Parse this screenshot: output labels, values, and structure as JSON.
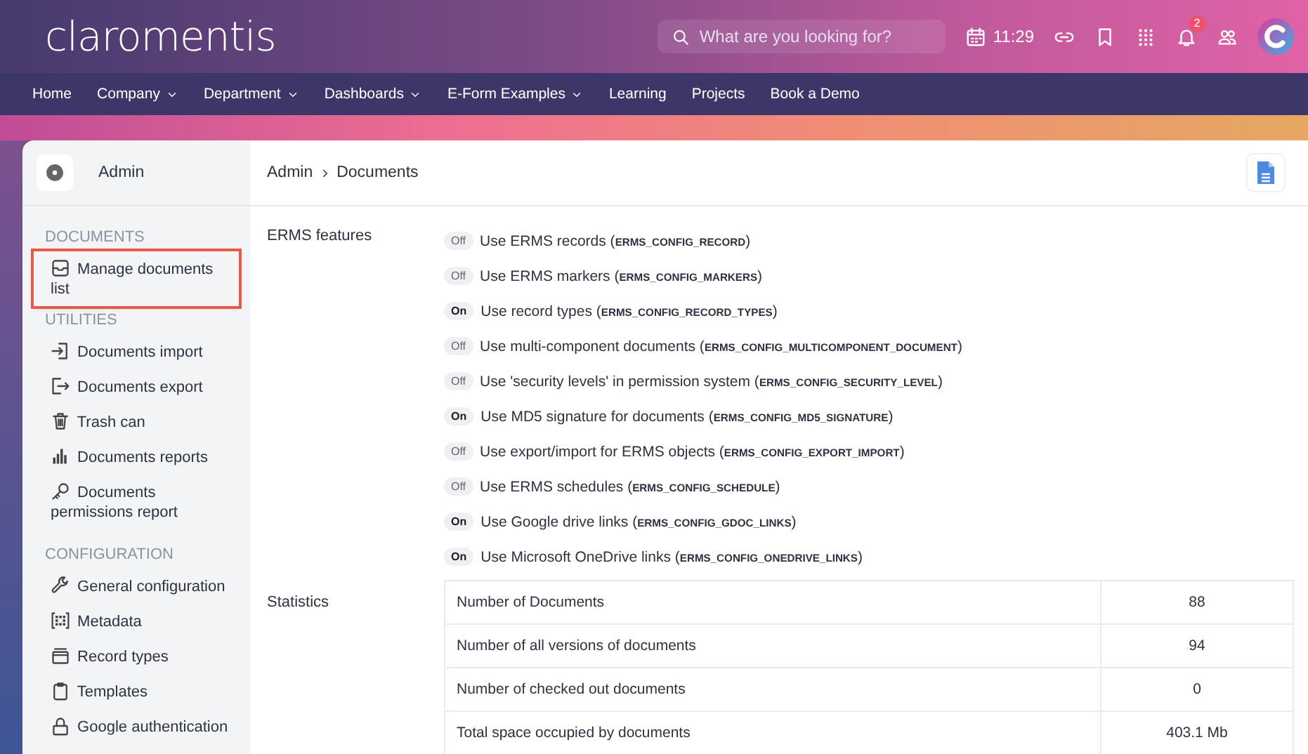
{
  "header": {
    "logo": "claromentis",
    "search": {
      "placeholder": "What are you looking for?"
    },
    "time": "11:29",
    "notification_count": "2"
  },
  "nav": [
    {
      "label": "Home",
      "dropdown": false
    },
    {
      "label": "Company",
      "dropdown": true
    },
    {
      "label": "Department",
      "dropdown": true
    },
    {
      "label": "Dashboards",
      "dropdown": true
    },
    {
      "label": "E-Form Examples",
      "dropdown": true
    },
    {
      "label": "Learning",
      "dropdown": false
    },
    {
      "label": "Projects",
      "dropdown": false
    },
    {
      "label": "Book a Demo",
      "dropdown": false
    }
  ],
  "sidebar": {
    "title": "Admin",
    "sections": [
      {
        "title": "DOCUMENTS",
        "items": [
          {
            "label": "Manage documents list",
            "highlighted": true
          }
        ]
      },
      {
        "title": "UTILITIES",
        "items": [
          {
            "label": "Documents import",
            "highlighted": false
          },
          {
            "label": "Documents export",
            "highlighted": false
          },
          {
            "label": "Trash can",
            "highlighted": false
          },
          {
            "label": "Documents reports",
            "highlighted": false
          },
          {
            "label": "Documents permissions report",
            "highlighted": false
          }
        ]
      },
      {
        "title": "CONFIGURATION",
        "items": [
          {
            "label": "General configuration",
            "highlighted": false
          },
          {
            "label": "Metadata",
            "highlighted": false
          },
          {
            "label": "Record types",
            "highlighted": false
          },
          {
            "label": "Templates",
            "highlighted": false
          },
          {
            "label": "Google authentication",
            "highlighted": false
          }
        ]
      }
    ]
  },
  "breadcrumb": [
    "Admin",
    "Documents"
  ],
  "features_label": "ERMS features",
  "features": [
    {
      "badge": "Off",
      "on": false,
      "text": "Use ERMS records (**ERMS_CONFIG_RECORD**)"
    },
    {
      "badge": "Off",
      "on": false,
      "text": "Use ERMS markers (**ERMS_CONFIG_MARKERS**)"
    },
    {
      "badge": "On",
      "on": true,
      "text": "Use record types (**ERMS_CONFIG_RECORD_TYPES**)"
    },
    {
      "badge": "Off",
      "on": false,
      "text": "Use multi-component documents (**ERMS_CONFIG_MULTICOMPONENT_DOCUMENT**)"
    },
    {
      "badge": "Off",
      "on": false,
      "text": "Use 'security levels' in permission system (**ERMS_CONFIG_SECURITY_LEVEL**)"
    },
    {
      "badge": "On",
      "on": true,
      "text": "Use MD5 signature for documents (**ERMS_CONFIG_MD5_SIGNATURE**)"
    },
    {
      "badge": "Off",
      "on": false,
      "text": "Use export/import for ERMS objects (**ERMS_CONFIG_EXPORT_IMPORT**)"
    },
    {
      "badge": "Off",
      "on": false,
      "text": "Use ERMS schedules (**ERMS_CONFIG_SCHEDULE**)"
    },
    {
      "badge": "On",
      "on": true,
      "text": "Use Google drive links (**ERMS_CONFIG_GDOC_LINKS**)"
    },
    {
      "badge": "On",
      "on": true,
      "text": "Use Microsoft OneDrive links (**ERMS_CONFIG_ONEDRIVE_LINKS**)"
    }
  ],
  "statistics_label": "Statistics",
  "statistics": [
    {
      "name": "Number of Documents",
      "value": "88"
    },
    {
      "name": "Number of all versions of documents",
      "value": "94"
    },
    {
      "name": "Number of checked out documents",
      "value": "0"
    },
    {
      "name": "Total space occupied by documents",
      "value": "403.1 Mb"
    }
  ]
}
